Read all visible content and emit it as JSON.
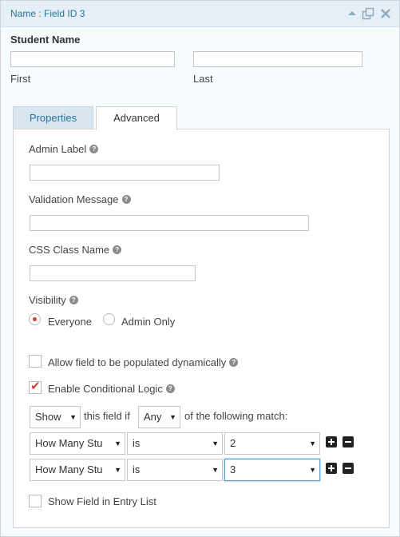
{
  "header": {
    "title": "Name : Field ID 3",
    "icons": [
      "collapse-up-icon",
      "duplicate-icon",
      "delete-x-icon"
    ]
  },
  "field": {
    "label": "Student Name",
    "first_label": "First",
    "last_label": "Last",
    "first_value": "",
    "last_value": ""
  },
  "tabs": [
    {
      "label": "Properties",
      "active": false
    },
    {
      "label": "Advanced",
      "active": true
    }
  ],
  "advanced": {
    "admin_label": "Admin Label",
    "admin_label_value": "",
    "validation_message": "Validation Message",
    "validation_message_value": "",
    "css_class_name": "CSS Class Name",
    "css_class_name_value": "",
    "visibility": "Visibility",
    "visibility_options": [
      {
        "label": "Everyone",
        "selected": true
      },
      {
        "label": "Admin Only",
        "selected": false
      }
    ],
    "allow_dynamic": {
      "label": "Allow field to be populated dynamically",
      "checked": false
    },
    "conditional_logic": {
      "label": "Enable Conditional Logic",
      "checked": true
    },
    "logic": {
      "action": "Show",
      "text_mid": "this field if",
      "match": "Any",
      "text_end": "of the following match:",
      "rules": [
        {
          "field": "How Many Students",
          "field_shown": "How Many Stu",
          "operator": "is",
          "value": "2",
          "focused": false
        },
        {
          "field": "How Many Students",
          "field_shown": "How Many Stu",
          "operator": "is",
          "value": "3",
          "focused": true
        }
      ]
    },
    "show_in_entry_list": {
      "label": "Show Field in Entry List",
      "checked": false
    }
  },
  "colors": {
    "accent_blue": "#21759b",
    "check_red": "#dd3d36",
    "panel_bg": "#f6fbfd",
    "titlebar_bg": "#e6eff5"
  }
}
